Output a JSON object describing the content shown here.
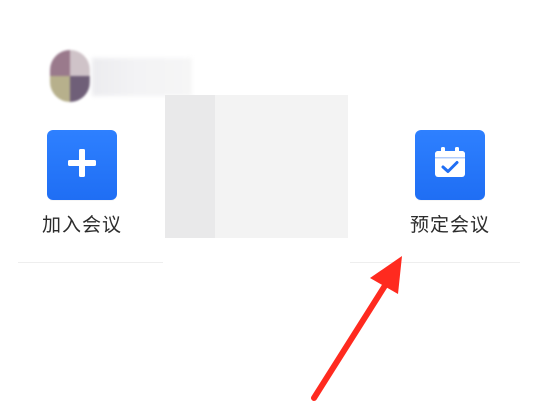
{
  "actions": {
    "join": {
      "label": "加入会议",
      "icon": "plus-icon",
      "color": "#2a7bff"
    },
    "schedule": {
      "label": "预定会议",
      "icon": "calendar-check-icon",
      "color": "#2a7bff"
    }
  },
  "annotation": {
    "arrow_color": "#ff2a1f"
  }
}
